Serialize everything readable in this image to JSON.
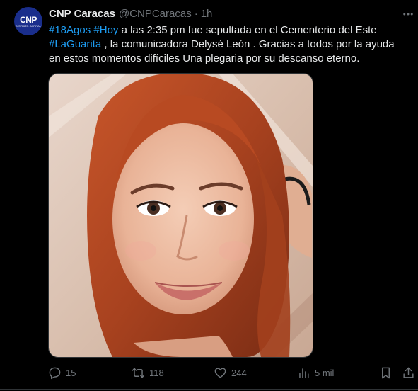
{
  "tweet": {
    "avatar_text": "CNP",
    "avatar_subtext": "DISTRITO CAPITAL",
    "author_name": "CNP Caracas",
    "handle": "@CNPCaracas",
    "separator": "·",
    "time": "1h",
    "text": {
      "line1": {
        "tag1": "#18Agos",
        "tag2": "#Hoy",
        "rest": " a las 2:35 pm fue sepultada en el Cementerio del Este"
      },
      "line2": {
        "tag": "#LaGuarita",
        "rest": " ,  la comunicadora Delysé León . Gracias a todos por la ayuda"
      },
      "line3": "en estos momentos difíciles  Una plegaria por su descanso eterno."
    },
    "image_alt": "Foto de Delysé León"
  },
  "actions": {
    "replies": "15",
    "reposts": "118",
    "likes": "244",
    "views": "5 mil"
  },
  "colors": {
    "background": "#000000",
    "text": "#e7e9ea",
    "secondary": "#71767b",
    "link": "#1d9bf0",
    "avatar_bg": "#1a2e8c"
  },
  "icons": [
    "more-icon",
    "reply-icon",
    "repost-icon",
    "like-icon",
    "views-icon",
    "bookmark-icon",
    "share-icon"
  ]
}
